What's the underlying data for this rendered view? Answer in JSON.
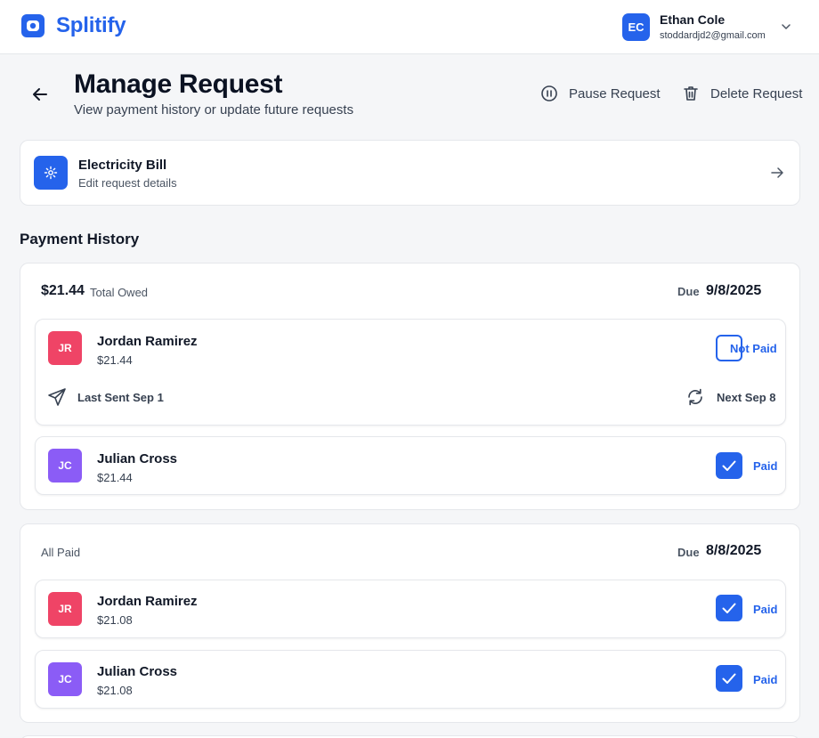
{
  "app": {
    "brand": "Splitify",
    "user": {
      "initials": "EC",
      "name": "Ethan Cole",
      "email": "stoddardjd2@gmail.com"
    }
  },
  "header": {
    "title": "Manage Request",
    "subtitle": "View payment history or update future requests",
    "pause_label": "Pause Request",
    "delete_label": "Delete Request"
  },
  "bill": {
    "title": "Electricity Bill",
    "subtitle": "Edit request details"
  },
  "history": {
    "title": "Payment History",
    "due_label": "Due",
    "groups": [
      {
        "amount": "$21.44",
        "amount_note": "Total Owed",
        "due_date": "9/8/2025",
        "members": [
          {
            "initials": "JR",
            "name": "Jordan Ramirez",
            "amount": "$21.44",
            "status": "Not Paid",
            "last_sent": "Last Sent Sep 1",
            "next": "Next Sep 8"
          },
          {
            "initials": "JC",
            "name": "Julian Cross",
            "amount": "$21.44",
            "status": "Paid"
          }
        ]
      },
      {
        "status_text": "All Paid",
        "due_date": "8/8/2025",
        "members": [
          {
            "initials": "JR",
            "name": "Jordan Ramirez",
            "amount": "$21.08",
            "status": "Paid"
          },
          {
            "initials": "JC",
            "name": "Julian Cross",
            "amount": "$21.08",
            "status": "Paid"
          }
        ]
      }
    ]
  },
  "colors": {
    "accent": "#2563eb",
    "avatar_red": "#ef4466",
    "avatar_purple": "#8b5cf6"
  }
}
